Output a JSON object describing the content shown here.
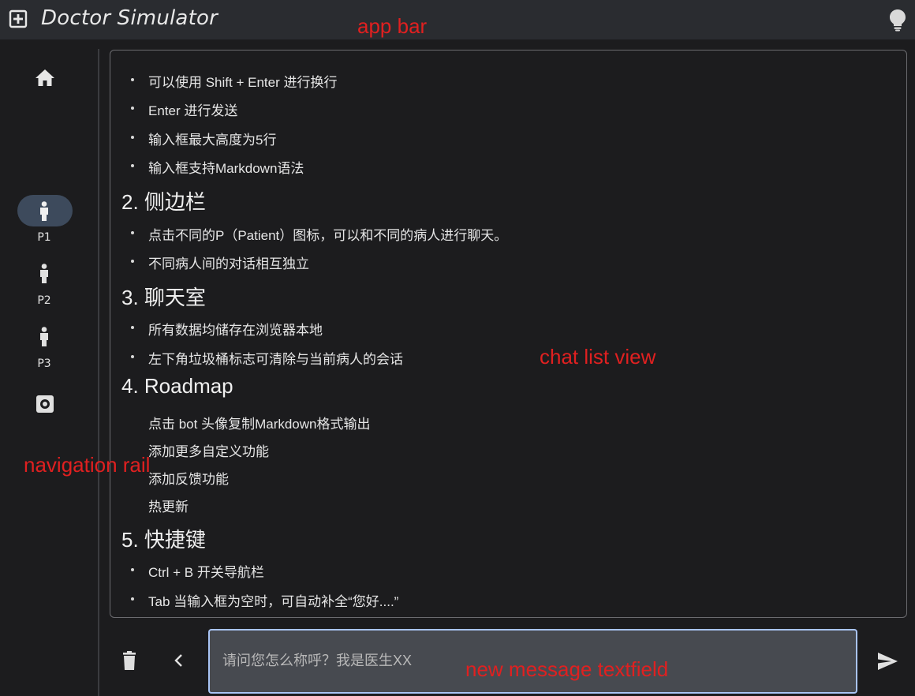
{
  "app_bar": {
    "title": "Doctor Simulator",
    "icon": "add-box-icon",
    "theme_toggle_icon": "lightbulb-icon"
  },
  "annotations": {
    "app_bar": "app bar",
    "chat_list": "chat list view",
    "nav_rail": "navigation rail",
    "textfield": "new message textfield"
  },
  "rail": {
    "home_icon": "home-icon",
    "items": [
      {
        "label": "P1",
        "icon": "person-icon",
        "active": true
      },
      {
        "label": "P2",
        "icon": "person-icon",
        "active": false
      },
      {
        "label": "P3",
        "icon": "person-icon",
        "active": false
      }
    ],
    "settings_icon": "settings-icon"
  },
  "chat": {
    "list1": [
      "可以使用 Shift + Enter 进行换行",
      "Enter 进行发送",
      "输入框最大高度为5行",
      "输入框支持Markdown语法"
    ],
    "h_sidebar": "2. 侧边栏",
    "list2": [
      "点击不同的P（Patient）图标，可以和不同的病人进行聊天。",
      "不同病人间的对话相互独立"
    ],
    "h_chatroom": "3. 聊天室",
    "list3": [
      "所有数据均储存在浏览器本地",
      "左下角垃圾桶标志可清除与当前病人的会话"
    ],
    "h_roadmap": "4. Roadmap",
    "list4": [
      "点击 bot 头像复制Markdown格式输出",
      "添加更多自定义功能",
      "添加反馈功能",
      "热更新"
    ],
    "h_shortcuts": "5. 快捷键",
    "list5": [
      "Ctrl + B 开关导航栏",
      "Tab 当输入框为空时，可自动补全“您好....”"
    ]
  },
  "input": {
    "placeholder": "请问您怎么称呼？我是医生XX",
    "value": ""
  },
  "colors": {
    "background": "#1c1c1e",
    "app_bar": "#2a2c30",
    "active_pill": "#3d4a5c",
    "textfield_border": "#a9c4f5",
    "textfield_fill": "#474a50",
    "annotation": "#e02020"
  }
}
